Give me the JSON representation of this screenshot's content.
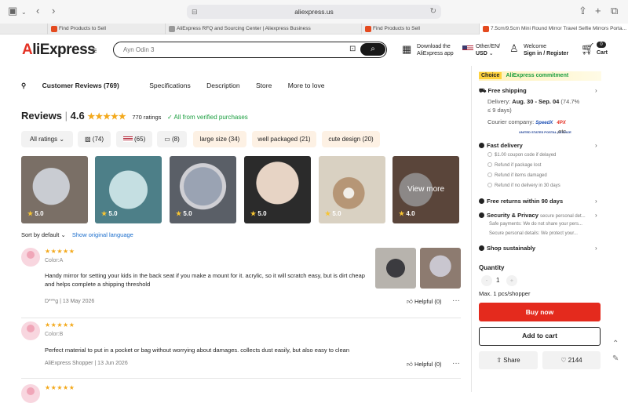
{
  "browser": {
    "url": "aliexpress.us",
    "tabs": [
      {
        "label": "Find Products to Sell"
      },
      {
        "label": "AliExpress RFQ and Sourcing Center | Aliexpress Business"
      },
      {
        "label": "Find Products to Sell"
      },
      {
        "label": "7.5cm/9.5cm Mini Round Mirror Travel Selfie Mirrors Porta..."
      }
    ]
  },
  "header": {
    "logo_a": "A",
    "logo_rest": "liExpress",
    "search_placeholder": "Ayn Odin 3",
    "app_line1": "Download the",
    "app_line2": "AliExpress app",
    "locale_line1": "Other/EN/",
    "locale_line2": "USD",
    "welcome": "Welcome",
    "signin": "Sign in / Register",
    "cart_count": "0",
    "cart_label": "Cart"
  },
  "section_nav": {
    "customer_reviews": "Customer Reviews (769)",
    "specifications": "Specifications",
    "description": "Description",
    "store": "Store",
    "more_to_love": "More to love"
  },
  "reviews_summary": {
    "title": "Reviews",
    "score": "4.6",
    "ratings": "770 ratings",
    "verified": "All from verified purchases"
  },
  "filters": [
    {
      "label": "All ratings"
    },
    {
      "label": "(74)"
    },
    {
      "label": "(65)"
    },
    {
      "label": "(8)"
    },
    {
      "label": "large size (34)"
    },
    {
      "label": "well packaged (21)"
    },
    {
      "label": "cute design (20)"
    }
  ],
  "thumbnails": [
    {
      "rating": "5.0"
    },
    {
      "rating": "5.0"
    },
    {
      "rating": "5.0"
    },
    {
      "rating": "5.0"
    },
    {
      "rating": "5.0"
    },
    {
      "rating": "4.0",
      "overlay": "View more"
    }
  ],
  "sort": {
    "label": "Sort by default",
    "link": "Show original language"
  },
  "reviews": [
    {
      "stars": "★★★★★",
      "variant": "Color:A",
      "text": "Handy mirror for setting your kids in the back seat if you make a mount for it. acrylic, so it will scratch easy, but is dirt cheap and helps complete a shipping threshold",
      "meta": "D***g | 13 May 2026",
      "helpful": "Helpful (0)"
    },
    {
      "stars": "★★★★★",
      "variant": "Color:B",
      "text": "Perfect material to put in a pocket or bag without worrying about damages. collects dust easily, but also easy to clean",
      "meta": "AliExpress Shopper | 13 Jun 2026",
      "helpful": "Helpful (0)"
    },
    {
      "stars": "★★★★★"
    }
  ],
  "side_panel": {
    "choice_badge": "Choice",
    "commitment": "AliExpress commitment",
    "free_shipping": "Free shipping",
    "delivery_label": "Delivery:",
    "delivery_dates": "Aug. 30 - Sep. 04",
    "delivery_pct": "(74.7%",
    "delivery_days": "≤ 9 days)",
    "courier_label": "Courier company:",
    "courier_speedx": "SpeedX",
    "courier_usps": "UNITED STATES POSTAL SERVICE",
    "courier_4px": "4PX",
    "courier_etc": ",etc.",
    "fast_delivery": "Fast delivery",
    "fast_items": [
      "$1.00 coupon code if delayed",
      "Refund if package lost",
      "Refund if items damaged",
      "Refund if no delivery in 30 days"
    ],
    "free_returns": "Free returns within 90 days",
    "security": "Security & Privacy",
    "security_sub": "secure personal det...",
    "safe_payments": "Safe payments: We do not share your pers...",
    "secure_details": "Secure personal details: We protect your...",
    "shop_sustainably": "Shop sustainably",
    "quantity_label": "Quantity",
    "qty_minus": "-",
    "qty_value": "1",
    "qty_plus": "+",
    "max_qty": "Max. 1 pcs/shopper",
    "buy_now": "Buy now",
    "add_to_cart": "Add to cart",
    "share": "Share",
    "likes": "2144"
  }
}
